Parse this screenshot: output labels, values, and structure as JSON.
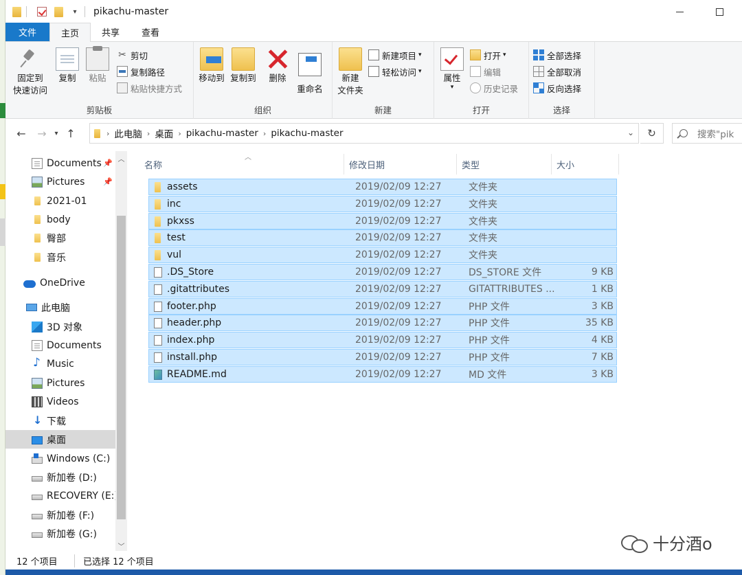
{
  "titlebar": {
    "title": "pikachu-master"
  },
  "ribbon_tabs": {
    "file": "文件",
    "home": "主页",
    "share": "共享",
    "view": "查看"
  },
  "ribbon": {
    "clipboard": {
      "pin_label": "固定到\n快速访问",
      "copy_label": "复制",
      "paste_label": "粘贴",
      "cut_label": "剪切",
      "copy_path_label": "复制路径",
      "paste_shortcut_label": "粘贴快捷方式",
      "group_label": "剪贴板"
    },
    "organize": {
      "move_to_label": "移动到",
      "copy_to_label": "复制到",
      "delete_label": "删除",
      "rename_label": "重命名",
      "group_label": "组织"
    },
    "new": {
      "new_folder_label": "新建\n文件夹",
      "new_item_label": "新建项目",
      "easy_access_label": "轻松访问",
      "group_label": "新建"
    },
    "open": {
      "properties_label": "属性",
      "open_label": "打开",
      "edit_label": "编辑",
      "history_label": "历史记录",
      "group_label": "打开"
    },
    "select": {
      "select_all_label": "全部选择",
      "select_none_label": "全部取消",
      "invert_label": "反向选择",
      "group_label": "选择"
    }
  },
  "address": {
    "segments": [
      "此电脑",
      "桌面",
      "pikachu-master",
      "pikachu-master"
    ],
    "search_placeholder": "搜索\"pik"
  },
  "nav_pane": {
    "items": [
      {
        "label": "Documents",
        "icon": "documents-icon"
      },
      {
        "label": "Pictures",
        "icon": "pictures-icon"
      },
      {
        "label": "2021-01",
        "icon": "folder-icon"
      },
      {
        "label": "body",
        "icon": "folder-icon"
      },
      {
        "label": "臀部",
        "icon": "folder-icon"
      },
      {
        "label": "音乐",
        "icon": "folder-icon"
      },
      {
        "label": "OneDrive",
        "icon": "onedrive-icon"
      },
      {
        "label": "此电脑",
        "icon": "this-pc-icon"
      },
      {
        "label": "3D 对象",
        "icon": "3d-objects-icon"
      },
      {
        "label": "Documents",
        "icon": "documents-icon"
      },
      {
        "label": "Music",
        "icon": "music-icon"
      },
      {
        "label": "Pictures",
        "icon": "pictures-icon"
      },
      {
        "label": "Videos",
        "icon": "videos-icon"
      },
      {
        "label": "下载",
        "icon": "downloads-icon"
      },
      {
        "label": "桌面",
        "icon": "desktop-icon"
      },
      {
        "label": "Windows (C:)",
        "icon": "windows-drive-icon"
      },
      {
        "label": "新加卷 (D:)",
        "icon": "drive-icon"
      },
      {
        "label": "RECOVERY (E:)",
        "icon": "drive-icon"
      },
      {
        "label": "新加卷 (F:)",
        "icon": "drive-icon"
      },
      {
        "label": "新加卷 (G:)",
        "icon": "drive-icon"
      }
    ],
    "selected": "桌面"
  },
  "columns": {
    "name": "名称",
    "modified": "修改日期",
    "type": "类型",
    "size": "大小"
  },
  "files": [
    {
      "name": "assets",
      "modified": "2019/02/09 12:27",
      "type": "文件夹",
      "size": "",
      "kind": "folder"
    },
    {
      "name": "inc",
      "modified": "2019/02/09 12:27",
      "type": "文件夹",
      "size": "",
      "kind": "folder"
    },
    {
      "name": "pkxss",
      "modified": "2019/02/09 12:27",
      "type": "文件夹",
      "size": "",
      "kind": "folder"
    },
    {
      "name": "test",
      "modified": "2019/02/09 12:27",
      "type": "文件夹",
      "size": "",
      "kind": "folder"
    },
    {
      "name": "vul",
      "modified": "2019/02/09 12:27",
      "type": "文件夹",
      "size": "",
      "kind": "folder"
    },
    {
      "name": ".DS_Store",
      "modified": "2019/02/09 12:27",
      "type": "DS_STORE 文件",
      "size": "9 KB",
      "kind": "file"
    },
    {
      "name": ".gitattributes",
      "modified": "2019/02/09 12:27",
      "type": "GITATTRIBUTES ...",
      "size": "1 KB",
      "kind": "file"
    },
    {
      "name": "footer.php",
      "modified": "2019/02/09 12:27",
      "type": "PHP 文件",
      "size": "3 KB",
      "kind": "file"
    },
    {
      "name": "header.php",
      "modified": "2019/02/09 12:27",
      "type": "PHP 文件",
      "size": "35 KB",
      "kind": "file"
    },
    {
      "name": "index.php",
      "modified": "2019/02/09 12:27",
      "type": "PHP 文件",
      "size": "4 KB",
      "kind": "file"
    },
    {
      "name": "install.php",
      "modified": "2019/02/09 12:27",
      "type": "PHP 文件",
      "size": "7 KB",
      "kind": "file"
    },
    {
      "name": "README.md",
      "modified": "2019/02/09 12:27",
      "type": "MD 文件",
      "size": "3 KB",
      "kind": "md"
    }
  ],
  "status": {
    "count": "12 个项目",
    "selected": "已选择 12 个项目"
  },
  "watermark": {
    "text": "十分酒o"
  },
  "colors": {
    "accent": "#1979ca",
    "selection": "#cce8ff",
    "selection_border": "#99d1ff"
  }
}
